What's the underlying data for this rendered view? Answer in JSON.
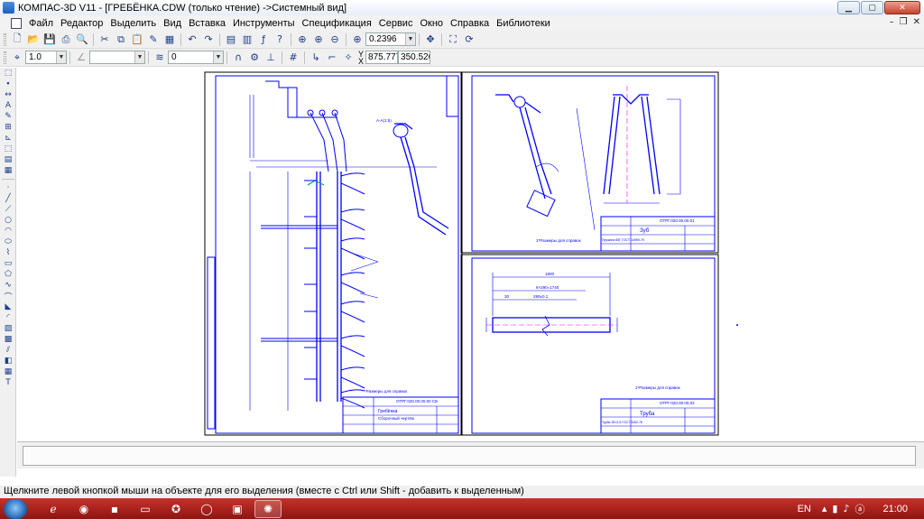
{
  "window": {
    "title": "КОМПАС-3D V11 - [ГРЕБЁНКА.CDW (только чтение) ->Системный вид]",
    "controls": {
      "minimize": "▁",
      "maximize": "▢",
      "close": "✕"
    }
  },
  "menu": {
    "items": [
      "Файл",
      "Редактор",
      "Выделить",
      "Вид",
      "Вставка",
      "Инструменты",
      "Спецификация",
      "Сервис",
      "Окно",
      "Справка",
      "Библиотеки"
    ],
    "mdi": {
      "minimize": "–",
      "restore": "❐",
      "close": "✕"
    }
  },
  "toolbar_main": {
    "zoom_value": "0.2396",
    "icons": [
      "new-document-icon",
      "open-icon",
      "save-icon",
      "print-icon",
      "print-preview-icon",
      "cut-icon",
      "copy-icon",
      "paste-icon",
      "format-painter-icon",
      "calculator-icon",
      "undo-icon",
      "redo-icon",
      "manager-icon",
      "variables-icon",
      "function-icon",
      "help-icon",
      "zoom-window-icon",
      "zoom-in-icon",
      "zoom-out-icon",
      "zoom-scale-icon",
      "pan-icon",
      "show-all-icon",
      "refresh-icon"
    ]
  },
  "toolbar_current": {
    "step_value": "1.0",
    "disabled_value": "",
    "layer_value": "0",
    "coord_x": "875.777",
    "coord_y": "350.526",
    "x_label": "X",
    "y_label": "Y"
  },
  "left_toolbar": {
    "icons": [
      "select-icon",
      "point-icon",
      "dimension-icon",
      "designation-icon",
      "editing-icon",
      "parametrization-icon",
      "measure-icon",
      "select-group-icon",
      "spec-icon",
      "report-icon",
      "pointer-icon",
      "line-icon",
      "circle-icon",
      "arc-icon",
      "ellipse-icon",
      "polyline-icon",
      "rectangle-icon",
      "spline-icon",
      "curve-icon",
      "chamfer-icon",
      "hatch-icon",
      "fragment-icon",
      "table-icon"
    ]
  },
  "drawing": {
    "sheet1": {
      "stamp_code": "ОТРГ.020.00.00.00 СБ",
      "stamp_name": "Гребёнка",
      "stamp_subtitle": "Сборочный чертёж",
      "note": "*Размеры для справок",
      "view_label": "А-А(1:5)"
    },
    "sheet2": {
      "stamp_code": "ОТРГ.020.00.00.01",
      "stamp_name": "Зуб",
      "stamp_material": "Пружина 65Г ГОСТ 14959-79",
      "note": "1*Размеры для справок"
    },
    "sheet3": {
      "stamp_code": "ОТРГ.020.00.00.02",
      "stamp_name": "Труба",
      "stamp_material": "Труба 25×2,5 ГОСТ 3262-75",
      "note": "1*Размеры для справок",
      "dim_overall": "1800",
      "dim_holes": "6×290=1740",
      "dim_first": "30",
      "dim_second": "290±0.1"
    }
  },
  "status": {
    "hint": "Щелкните левой кнопкой мыши на объекте для его выделения (вместе с Ctrl или Shift - добавить к выделенным)"
  },
  "taskbar": {
    "language": "EN",
    "clock": "21:00",
    "apps": [
      "ie-icon",
      "chrome-icon",
      "floppy-icon",
      "folder-icon",
      "avast-icon",
      "opera-icon",
      "explorer-icon",
      "kompas-icon"
    ]
  },
  "colors": {
    "drawing_line": "#0000ff",
    "taskbar": "#b52520"
  }
}
